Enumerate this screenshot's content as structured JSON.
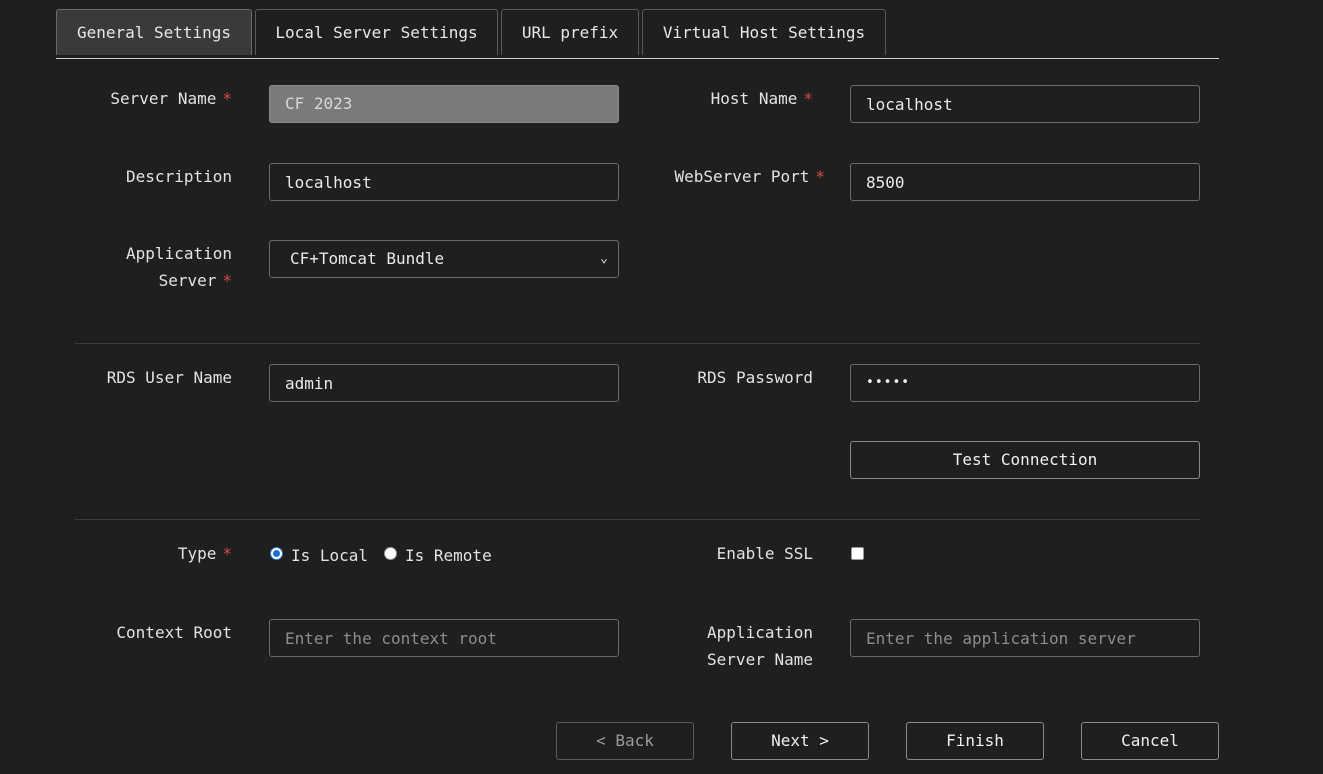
{
  "tabs": [
    {
      "label": "General Settings",
      "active": true
    },
    {
      "label": "Local Server Settings",
      "active": false
    },
    {
      "label": "URL prefix",
      "active": false
    },
    {
      "label": "Virtual Host Settings",
      "active": false
    }
  ],
  "form": {
    "server_name": {
      "label": "Server Name",
      "required": "*",
      "value": "CF 2023"
    },
    "host_name": {
      "label": "Host Name",
      "required": "*",
      "value": "localhost"
    },
    "description": {
      "label": "Description",
      "value": "localhost"
    },
    "webserver_port": {
      "label": "WebServer Port",
      "required": "*",
      "value": "8500"
    },
    "application_server": {
      "label_line1": "Application",
      "label_line2": "Server",
      "required": "*",
      "value": "CF+Tomcat Bundle"
    },
    "rds_user_name": {
      "label": "RDS User Name",
      "value": "admin"
    },
    "rds_password": {
      "label": "RDS Password",
      "value": "•••••"
    },
    "test_connection_label": "Test Connection",
    "type": {
      "label": "Type",
      "required": "*",
      "options": [
        "Is Local",
        "Is Remote"
      ],
      "selected": "Is Local"
    },
    "enable_ssl": {
      "label": "Enable SSL",
      "checked": false
    },
    "context_root": {
      "label": "Context Root",
      "placeholder": "Enter the context root"
    },
    "app_server_name": {
      "label_line1": "Application",
      "label_line2": "Server Name",
      "placeholder": "Enter the application server"
    }
  },
  "footer": {
    "back_label": "< Back",
    "next_label": "Next >",
    "finish_label": "Finish",
    "cancel_label": "Cancel"
  },
  "icons": {
    "select_chevron": "chevron-down-icon"
  },
  "colors": {
    "background": "#1f1f1f",
    "required": "#e04848",
    "radio_accent": "#1a6fd6"
  }
}
